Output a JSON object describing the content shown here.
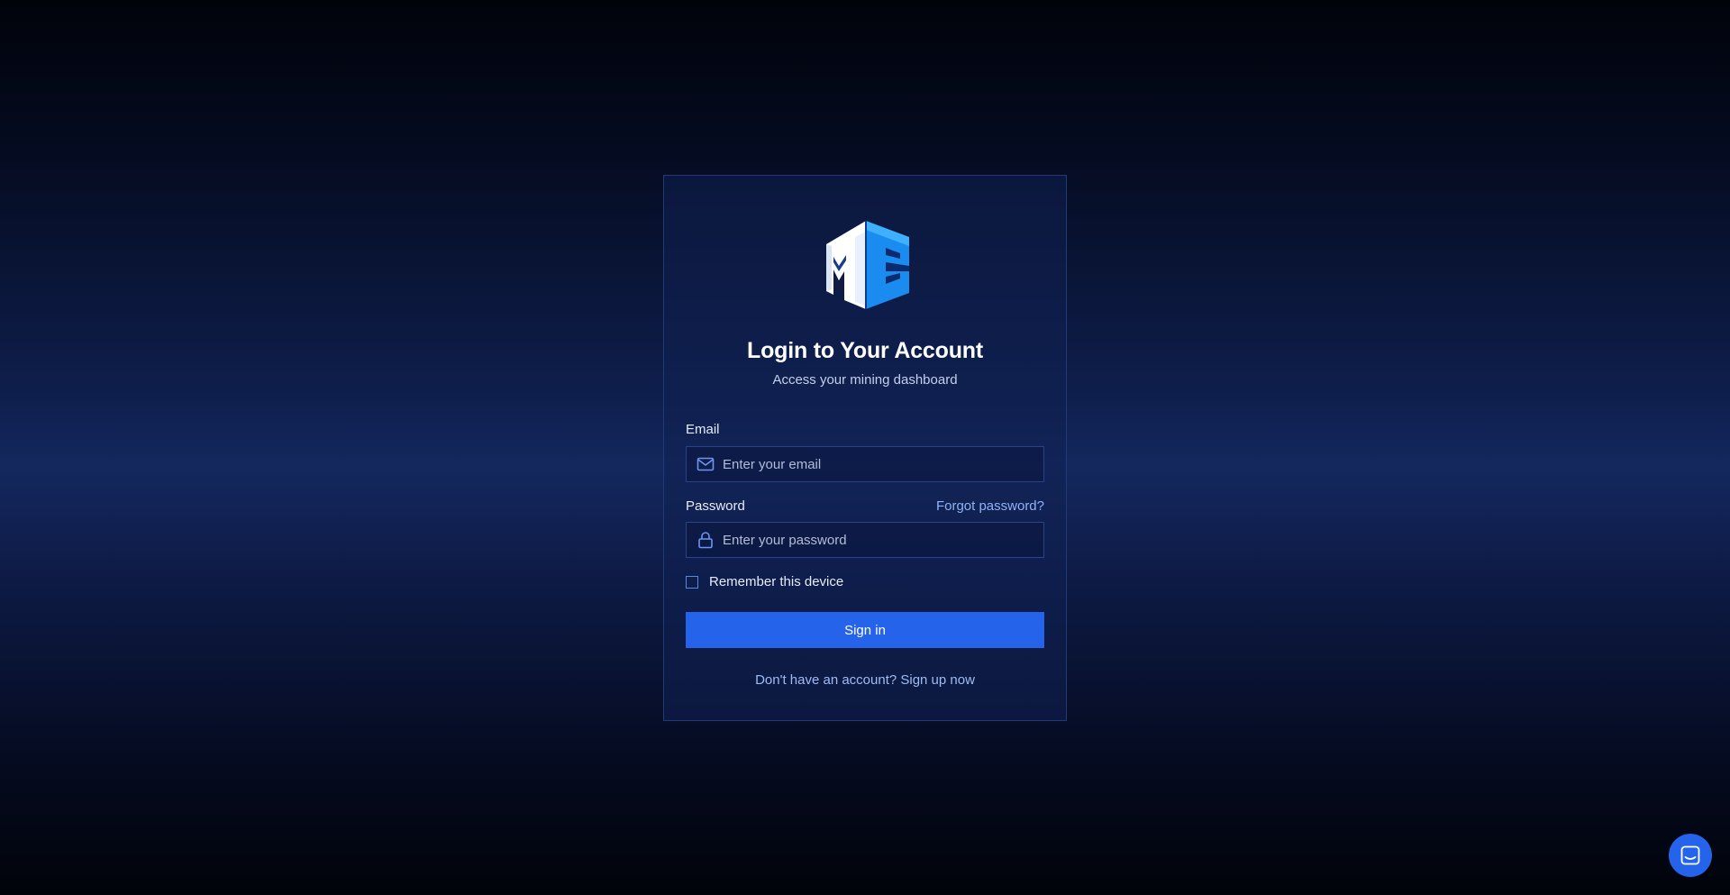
{
  "brand": {
    "logo_text": "MC",
    "logo_colors": {
      "light": "#ffffff",
      "accent": "#1a8cf0",
      "dark": "#0b5fc9"
    }
  },
  "login": {
    "title": "Login to Your Account",
    "subtitle": "Access your mining dashboard",
    "email_label": "Email",
    "email_placeholder": "Enter your email",
    "email_value": "",
    "password_label": "Password",
    "password_placeholder": "Enter your password",
    "password_value": "",
    "forgot_password": "Forgot password?",
    "remember_label": "Remember this device",
    "remember_checked": false,
    "signin_label": "Sign in",
    "signup_text": "Don't have an account? Sign up now"
  },
  "icons": {
    "email": "mail-icon",
    "password": "lock-icon",
    "chat": "chat-icon"
  },
  "colors": {
    "primary": "#2563eb",
    "link": "#8fb3f7",
    "card_border": "#233a7a"
  }
}
